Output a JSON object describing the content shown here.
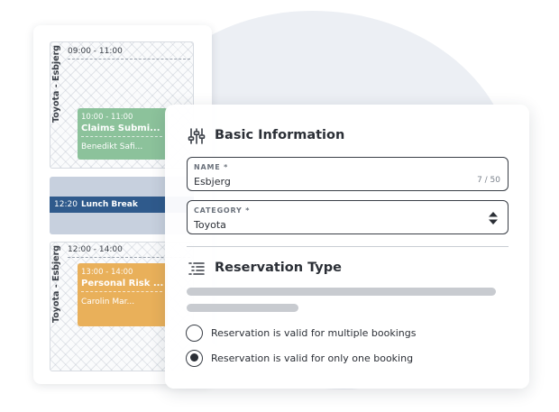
{
  "calendar": {
    "blocks": [
      {
        "resource": "Toyota - Esbjerg",
        "time_range": "09:00 - 11:00",
        "event": {
          "time": "10:00 - 11:00",
          "title": "Claims Submi...",
          "person": "Benedikt Safi..."
        }
      },
      {
        "resource": "Toyota - Esbjerg",
        "time_range": "12:00 - 14:00",
        "event": {
          "time": "13:00 - 14:00",
          "title": "Personal Risk ...",
          "person": "Carolin Mar..."
        }
      }
    ],
    "lunch": {
      "time": "12:20",
      "label": "Lunch Break"
    }
  },
  "form": {
    "basic_title": "Basic Information",
    "basic_icon": "sliders-icon",
    "name_field": {
      "label": "NAME *",
      "value": "Esbjerg",
      "counter": "7 / 50"
    },
    "category_field": {
      "label": "CATEGORY *",
      "value": "Toyota"
    },
    "reservation_title": "Reservation Type",
    "reservation_icon": "list-icon",
    "options": [
      {
        "label": "Reservation is valid for multiple bookings",
        "checked": false
      },
      {
        "label": "Reservation is valid for only one booking",
        "checked": true
      }
    ]
  },
  "colors": {
    "event_green": "#8cc29b",
    "event_orange": "#e9b05a",
    "lunch_bar": "#2f5a8c",
    "background_blob": "#eceff4"
  }
}
